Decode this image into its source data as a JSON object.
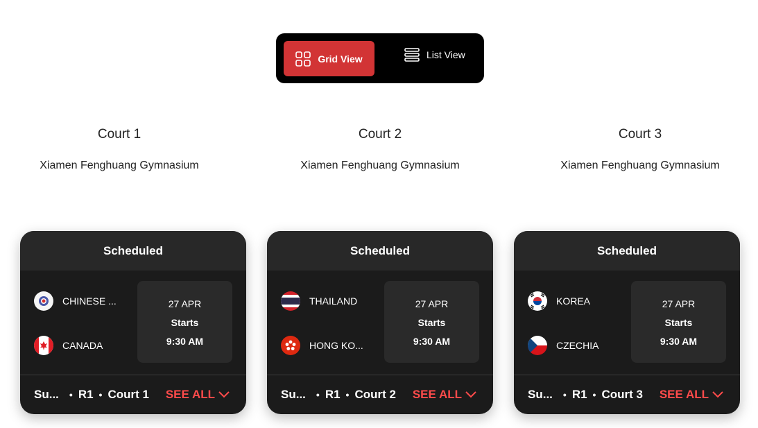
{
  "view_toggle": {
    "grid_label": "Grid View",
    "list_label": "List View",
    "active_color": "#d23435",
    "grid_icon": "grid-icon",
    "list_icon": "list-icon"
  },
  "courts": [
    {
      "name": "Court 1",
      "venue": "Xiamen Fenghuang Gymnasium",
      "card": {
        "status": "Scheduled",
        "team1": {
          "name": "CHINESE ...",
          "flag": "chinese-taipei-flag-icon"
        },
        "team2": {
          "name": "CANADA",
          "flag": "canada-flag-icon"
        },
        "date": "27 APR",
        "starts_label": "Starts",
        "time": "9:30 AM",
        "footer": {
          "session": "Su...",
          "round": "R1",
          "court": "Court 1"
        },
        "see_all": "SEE ALL"
      }
    },
    {
      "name": "Court 2",
      "venue": "Xiamen Fenghuang Gymnasium",
      "card": {
        "status": "Scheduled",
        "team1": {
          "name": "THAILAND",
          "flag": "thailand-flag-icon"
        },
        "team2": {
          "name": "HONG KO...",
          "flag": "hong-kong-flag-icon"
        },
        "date": "27 APR",
        "starts_label": "Starts",
        "time": "9:30 AM",
        "footer": {
          "session": "Su...",
          "round": "R1",
          "court": "Court 2"
        },
        "see_all": "SEE ALL"
      }
    },
    {
      "name": "Court 3",
      "venue": "Xiamen Fenghuang Gymnasium",
      "card": {
        "status": "Scheduled",
        "team1": {
          "name": "KOREA",
          "flag": "korea-flag-icon"
        },
        "team2": {
          "name": "CZECHIA",
          "flag": "czechia-flag-icon"
        },
        "date": "27 APR",
        "starts_label": "Starts",
        "time": "9:30 AM",
        "footer": {
          "session": "Su...",
          "round": "R1",
          "court": "Court 3"
        },
        "see_all": "SEE ALL"
      }
    }
  ],
  "colors": {
    "card_bg": "#1b1b1b",
    "header_bg": "#282828",
    "accent_red": "#ff4b4b"
  }
}
